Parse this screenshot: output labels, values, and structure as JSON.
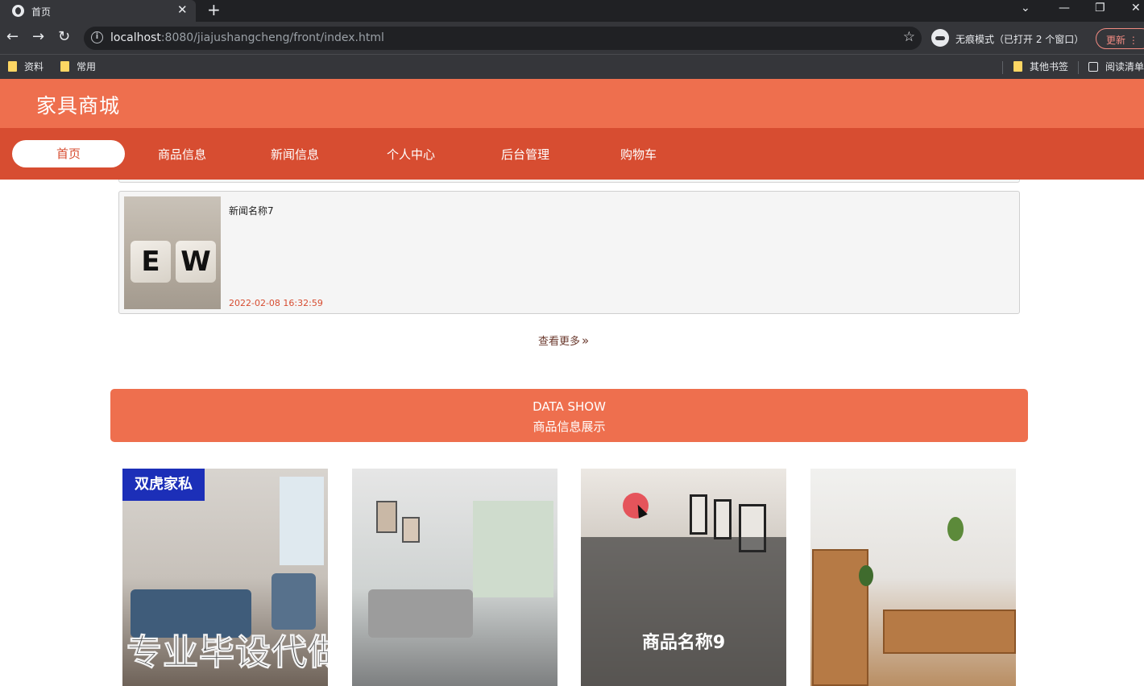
{
  "browser": {
    "tab_title": "首页",
    "url_host": "localhost",
    "url_rest": ":8080/jiajushangcheng/front/index.html",
    "incognito_label": "无痕模式（已打开 2 个窗口）",
    "update_label": "更新",
    "bookmarks": [
      "资料",
      "常用"
    ],
    "bookmarks_right": [
      "其他书签",
      "阅读清单"
    ]
  },
  "site": {
    "title": "家具商城",
    "nav": [
      "首页",
      "商品信息",
      "新闻信息",
      "个人中心",
      "后台管理",
      "购物车"
    ]
  },
  "news": {
    "title": "新闻名称7",
    "time": "2022-02-08 16:32:59",
    "thumb_letters": [
      "E",
      "W"
    ]
  },
  "more_label": "查看更多",
  "data_show": {
    "en": "DATA SHOW",
    "cn": "商品信息展示"
  },
  "products": {
    "brand_tag": "双虎家私",
    "watermark": "专业毕设代做",
    "hover_name": "商品名称9"
  },
  "colors": {
    "accent": "#ee6f4e",
    "nav_bg": "#d74d31"
  }
}
